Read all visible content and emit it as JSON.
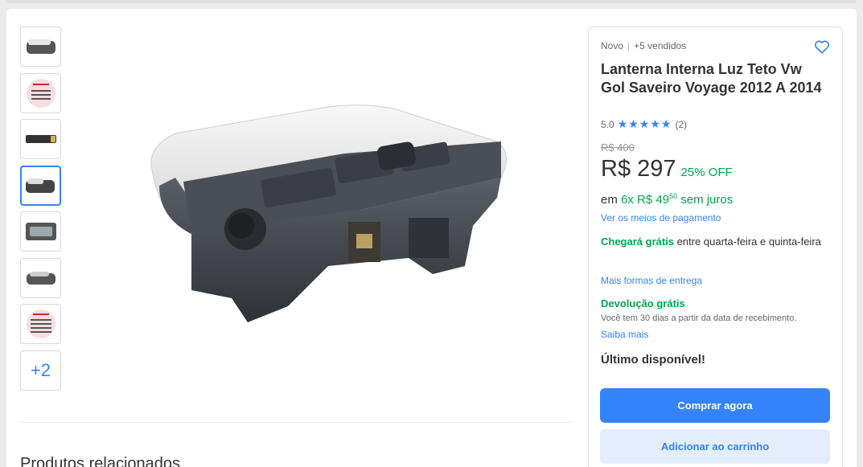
{
  "gallery": {
    "more_count": "+2"
  },
  "product": {
    "condition": "Novo",
    "sold": "+5 vendidos",
    "title": "Lanterna Interna Luz Teto Vw Gol Saveiro Voyage 2012 A 2014",
    "rating_value": "5.0",
    "stars": "★★★★★",
    "rating_count": "(2)",
    "old_price": "R$ 400",
    "price": "R$ 297",
    "discount": "25% OFF",
    "installments_prefix": "em ",
    "installments_green": "6x R$ 49",
    "installments_cents": "50",
    "installments_suffix": " sem juros",
    "payment_link": "Ver os meios de pagamento"
  },
  "shipping": {
    "highlight": "Chegará grátis",
    "text": " entre quarta-feira e quinta-feira",
    "link": "Mais formas de entrega"
  },
  "returns": {
    "title": "Devolução grátis",
    "description": "Você tem 30 dias a partir da data de recebimento.",
    "link": "Saiba mais"
  },
  "stock": "Último disponível!",
  "actions": {
    "buy": "Comprar agora",
    "cart": "Adicionar ao carrinho"
  },
  "related": {
    "heading": "Produtos relacionados"
  },
  "colors": {
    "accent": "#3483fa",
    "green": "#00a650"
  }
}
